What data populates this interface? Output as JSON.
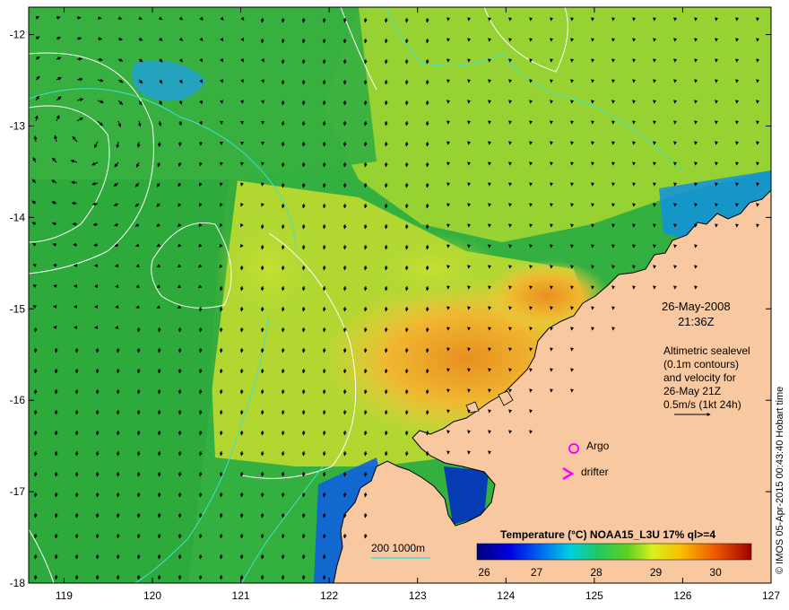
{
  "map": {
    "title_date": "26-May-2008",
    "title_time": "21:36Z",
    "altimetry_lines": [
      "Altimetric sealevel",
      "(0.1m contours)",
      "and velocity for",
      "26-May 21Z",
      "0.5m/s (1kt 24h)"
    ],
    "legend": {
      "argo_label": "Argo",
      "drifter_label": "drifter",
      "argo_marker": "circle-marker-icon",
      "drifter_marker": "chevron-marker-icon",
      "marker_color": "#ff00ff",
      "depth_contours_label": "200  1000m",
      "depth_contour_color": "#40e0d0"
    },
    "colorbar": {
      "title": "Temperature (°C) NOAA15_L3U 17% ql>=4",
      "ticks": [
        "26",
        "27",
        "28",
        "29",
        "30"
      ],
      "range": [
        26,
        30.6
      ]
    },
    "axes": {
      "x_ticks": [
        "119",
        "120",
        "121",
        "122",
        "123",
        "124",
        "125",
        "126",
        "127"
      ],
      "y_ticks": [
        "-12",
        "-13",
        "-14",
        "-15",
        "-16",
        "-17",
        "-18"
      ],
      "lon_range": [
        118.6,
        127
      ],
      "lat_range": [
        -18,
        -11.7
      ]
    },
    "credit": "© IMOS 05-Apr-2015 00:43:40 Hobart time",
    "colors": {
      "land": "#f8c8a0",
      "sea_base": "#3cb43c",
      "warm": "#e8a020",
      "cool": "#1ea0dc",
      "contour": "#ffffff",
      "arrow": "#000000"
    }
  }
}
